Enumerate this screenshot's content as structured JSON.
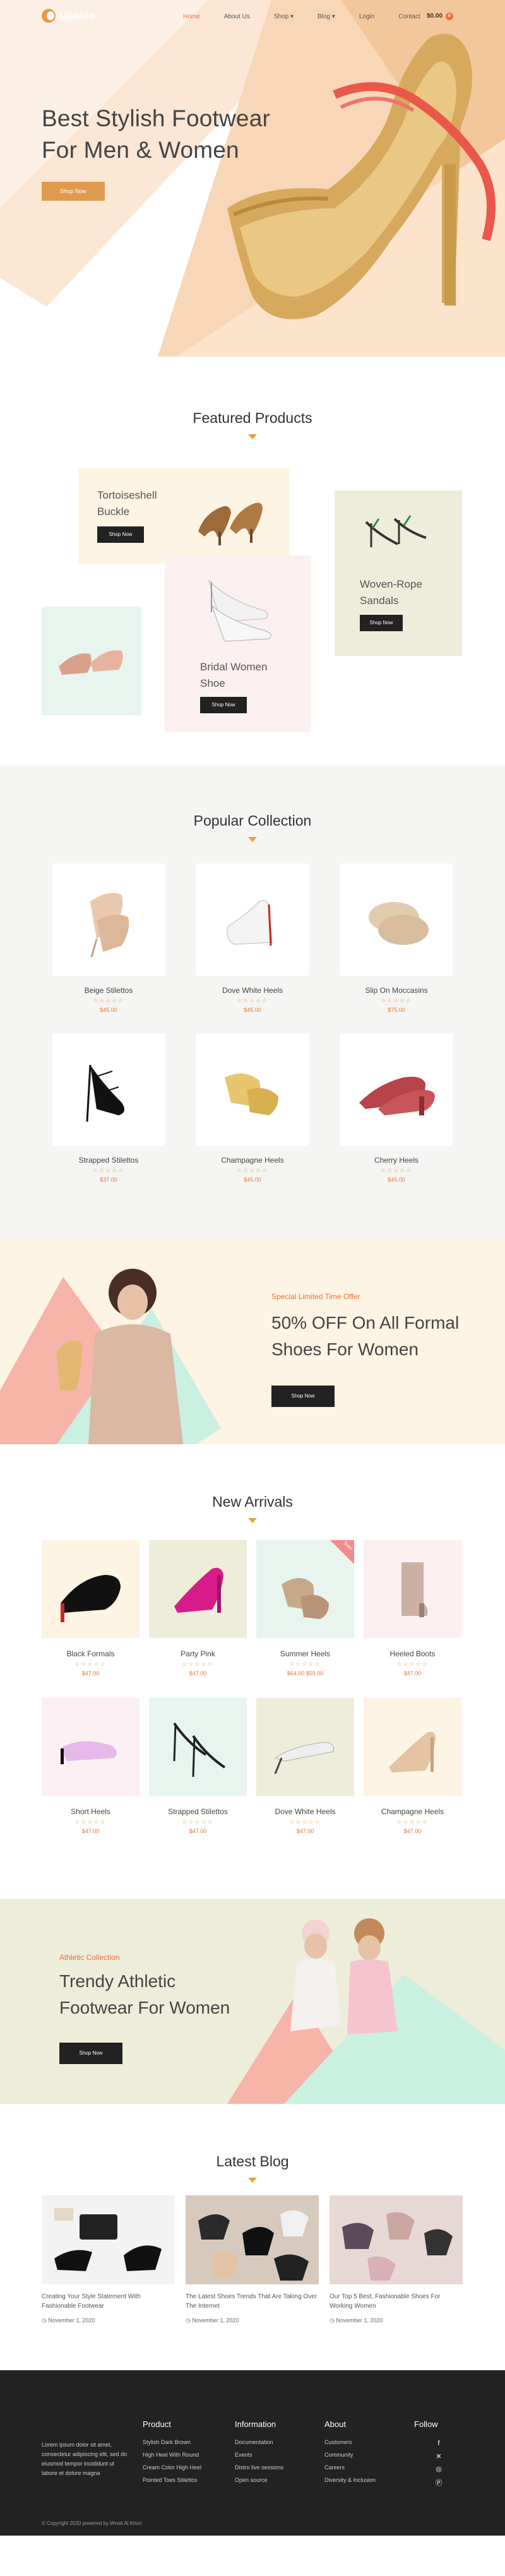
{
  "brand": {
    "name": "Upsole",
    "accent": "#e8713a"
  },
  "nav": {
    "items": [
      "Home",
      "About Us",
      "Shop",
      "Blog",
      "Login",
      "Contact"
    ],
    "cart_amount": "$0.00",
    "cart_count": "0"
  },
  "hero": {
    "title_line1": "Best Stylish Footwear",
    "title_line2": "For Men & Women",
    "button": "Shop Now"
  },
  "featured": {
    "title": "Featured Products",
    "cards": [
      {
        "line1": "Tortoiseshell",
        "line2": "Buckle",
        "button": "Shop Now",
        "bg": "#fdf4e3"
      },
      {
        "line1": "Bridal Women",
        "line2": "Shoe",
        "button": "Shop Now",
        "bg": "#fdf0f0"
      },
      {
        "line1": "Woven-Rope",
        "line2": "Sandals",
        "button": "Shop Now",
        "bg": "#eeedd9"
      }
    ]
  },
  "popular": {
    "title": "Popular Collection",
    "products": [
      {
        "name": "Beige Stilettos",
        "stars": "☆☆☆☆☆",
        "price": "$45.00"
      },
      {
        "name": "Dove White Heels",
        "stars": "☆☆☆☆☆",
        "price": "$45.00"
      },
      {
        "name": "Slip On Moccasins",
        "stars": "☆☆☆☆☆",
        "price": "$75.00"
      },
      {
        "name": "Strapped Stilettos",
        "stars": "☆☆☆☆☆",
        "price": "$37.00"
      },
      {
        "name": "Champagne Heels",
        "stars": "☆☆☆☆☆",
        "price": "$45.00"
      },
      {
        "name": "Cherry Heels",
        "stars": "☆☆☆☆☆",
        "price": "$45.00"
      }
    ]
  },
  "offer": {
    "kicker": "Special Limited Time Offer",
    "title_line1": "50% OFF On All Formal",
    "title_line2": "Shoes For Women",
    "button": "Shop Now"
  },
  "arrivals": {
    "title": "New Arrivals",
    "sale_badge": "Sale!",
    "products": [
      {
        "name": "Black Formals",
        "stars": "☆☆☆☆☆",
        "price": "$47.00",
        "bg": "#fdf4e3"
      },
      {
        "name": "Party Pink",
        "stars": "☆☆☆☆☆",
        "price": "$47.00",
        "bg": "#eeedd9"
      },
      {
        "name": "Summer Heels",
        "stars": "☆☆☆☆☆",
        "price": "$64.00 $59.00",
        "bg": "#e8f5ef"
      },
      {
        "name": "Heeled Boots",
        "stars": "☆☆☆☆☆",
        "price": "$47.00",
        "bg": "#fdf0f0"
      },
      {
        "name": "Short Heels",
        "stars": "☆☆☆☆☆",
        "price": "$47.00",
        "bg": "#fdf0f5"
      },
      {
        "name": "Strapped Stilettos",
        "stars": "☆☆☆☆☆",
        "price": "$47.00",
        "bg": "#e8f5ef"
      },
      {
        "name": "Dove White Heels",
        "stars": "☆☆☆☆☆",
        "price": "$47.00",
        "bg": "#eeedd9"
      },
      {
        "name": "Champagne Heels",
        "stars": "☆☆☆☆☆",
        "price": "$47.00",
        "bg": "#fdf4e3"
      }
    ]
  },
  "athletic": {
    "kicker": "Athletic Collection",
    "title_line1": "Trendy Athletic",
    "title_line2": "Footwear For Women",
    "button": "Shop Now"
  },
  "blog": {
    "title": "Latest Blog",
    "posts": [
      {
        "title": "Creating Your Style Statement With Fashionable Footwear",
        "date": "November 1, 2020"
      },
      {
        "title": "The Latest Shoes Trends That Are Taking Over The Internet",
        "date": "November 1, 2020"
      },
      {
        "title": "Our Top 5 Best, Fashionable Shoes For Working Women",
        "date": "November 1, 2020"
      }
    ]
  },
  "footer": {
    "about": "Lorem ipsum dolor sit amet, consectetur adipiscing elit, sed do eiusmod tempor incididunt ut labore et dolore magna",
    "product_title": "Product",
    "product_links": [
      "Stylish Dark Brown",
      "High Heel With Round",
      "Cream Color High Heel",
      "Pointed Toes Stilettos"
    ],
    "info_title": "Information",
    "info_links": [
      "Documentation",
      "Events",
      "Distro live sessions",
      "Open source"
    ],
    "about_title": "About",
    "about_links": [
      "Customers",
      "Community",
      "Careers",
      "Diversity & Inclusion"
    ],
    "follow_title": "Follow",
    "copyright": "© Copyright 2020 powered by Wnoit Al Khori"
  }
}
